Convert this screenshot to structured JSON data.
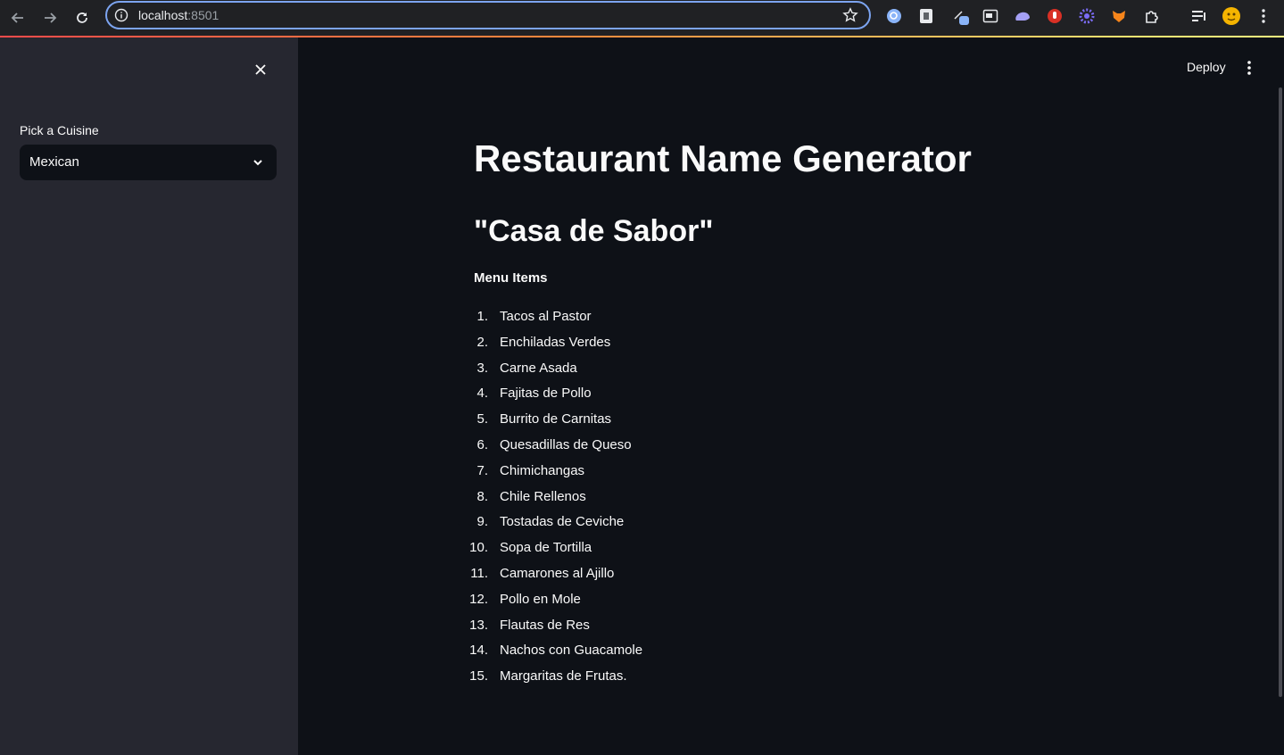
{
  "browser": {
    "url_host": "localhost",
    "url_port": ":8501",
    "back_icon": "back-arrow-icon",
    "forward_icon": "forward-arrow-icon",
    "reload_icon": "reload-icon",
    "extensions": [
      "search-extension-icon",
      "docs-extension-icon",
      "pen-extension-icon",
      "window-extension-icon",
      "cloud-extension-icon",
      "red-extension-icon",
      "gear-extension-icon",
      "fox-extension-icon",
      "puzzle-icon",
      "playlist-icon",
      "profile-avatar"
    ]
  },
  "sidebar": {
    "cuisine_label": "Pick a Cuisine",
    "cuisine_selected": "Mexican"
  },
  "header": {
    "deploy_label": "Deploy"
  },
  "main": {
    "title": "Restaurant Name Generator",
    "restaurant_name": "\"Casa de Sabor\"",
    "menu_heading": "Menu Items",
    "menu_items": [
      {
        "num": "1.",
        "label": "Tacos al Pastor"
      },
      {
        "num": "2.",
        "label": "Enchiladas Verdes"
      },
      {
        "num": "3.",
        "label": "Carne Asada"
      },
      {
        "num": "4.",
        "label": "Fajitas de Pollo"
      },
      {
        "num": "5.",
        "label": "Burrito de Carnitas"
      },
      {
        "num": "6.",
        "label": "Quesadillas de Queso"
      },
      {
        "num": "7.",
        "label": "Chimichangas"
      },
      {
        "num": "8.",
        "label": "Chile Rellenos"
      },
      {
        "num": "9.",
        "label": "Tostadas de Ceviche"
      },
      {
        "num": "10.",
        "label": "Sopa de Tortilla"
      },
      {
        "num": "11.",
        "label": "Camarones al Ajillo"
      },
      {
        "num": "12.",
        "label": "Pollo en Mole"
      },
      {
        "num": "13.",
        "label": "Flautas de Res"
      },
      {
        "num": "14.",
        "label": "Nachos con Guacamole"
      },
      {
        "num": "15.",
        "label": "Margaritas de Frutas."
      }
    ]
  },
  "colors": {
    "app_bg": "#0e1117",
    "sidebar_bg": "#262730",
    "text": "#fafafa",
    "omnibox_focus": "#7ca4f0"
  }
}
